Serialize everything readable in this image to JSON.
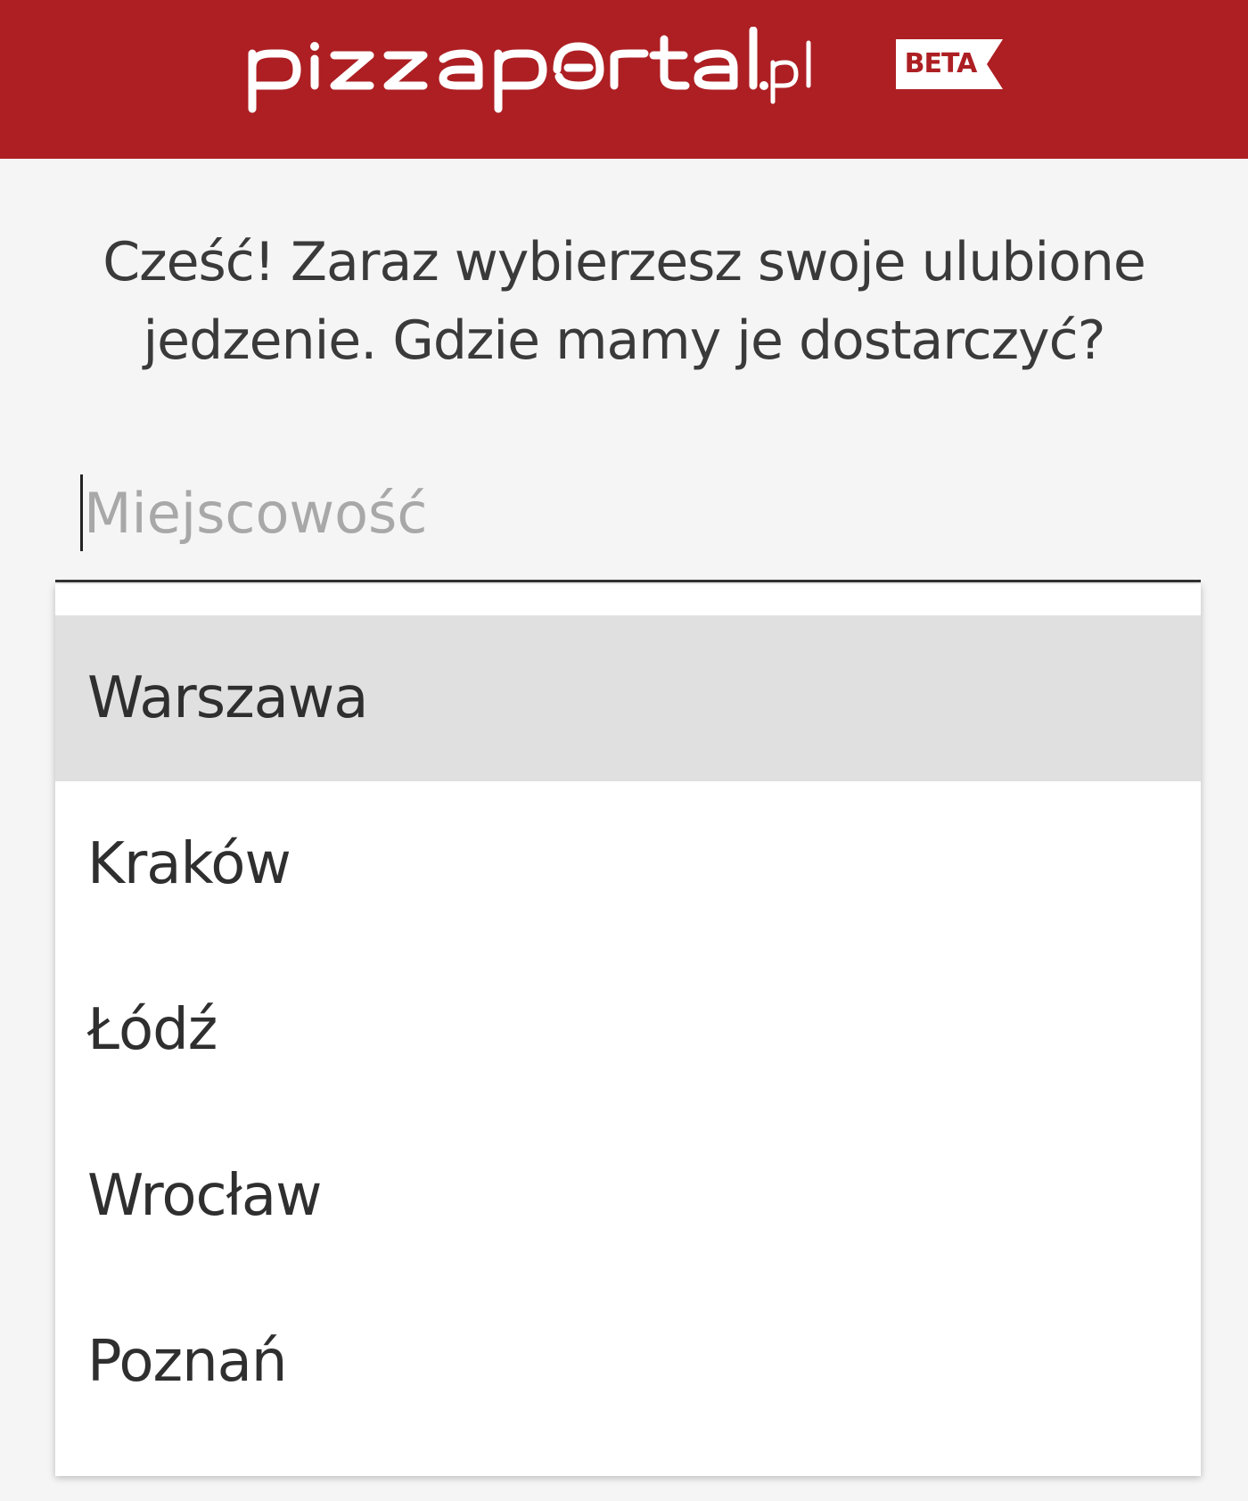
{
  "header": {
    "logo_text": "pizzaportal.pl",
    "badge": "BETA",
    "brand_color": "#ad1f23"
  },
  "greeting": {
    "line1": "Cześć! Zaraz wybierzesz swoje ulubione",
    "line2": "jedzenie. Gdzie mamy je dostarczyć?"
  },
  "city_input": {
    "placeholder": "Miejscowość",
    "value": ""
  },
  "dropdown": {
    "options": [
      {
        "label": "Warszawa",
        "highlighted": true
      },
      {
        "label": "Kraków",
        "highlighted": false
      },
      {
        "label": "Łódź",
        "highlighted": false
      },
      {
        "label": "Wrocław",
        "highlighted": false
      },
      {
        "label": "Poznań",
        "highlighted": false
      }
    ]
  }
}
